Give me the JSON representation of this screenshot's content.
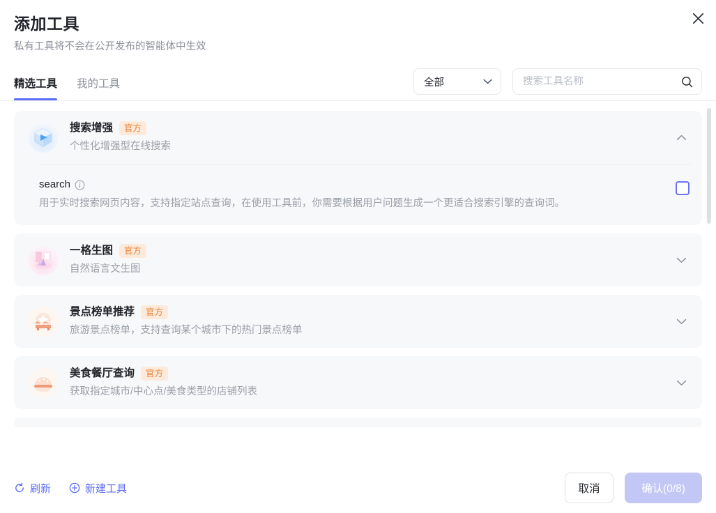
{
  "dialog": {
    "title": "添加工具",
    "subtitle": "私有工具将不会在公开发布的智能体中生效",
    "close_icon": "close-icon"
  },
  "tabs": [
    {
      "label": "精选工具",
      "active": true
    },
    {
      "label": "我的工具",
      "active": false
    }
  ],
  "filter": {
    "selected": "全部",
    "chevron_icon": "chevron-down-icon"
  },
  "search": {
    "value": "",
    "placeholder": "搜索工具名称",
    "icon": "search-icon"
  },
  "tools": [
    {
      "name": "搜索增强",
      "badge": "官方",
      "description": "个性化增强型在线搜索",
      "icon": "cube-icon",
      "expanded": true,
      "chevron_icon": "chevron-up-icon",
      "functions": [
        {
          "name": "search",
          "info_icon": "info-icon",
          "description": "用于实时搜索网页内容，支持指定站点查询，在使用工具前，你需要根据用户问题生成一个更适合搜索引擎的查询词。",
          "checked": false
        }
      ]
    },
    {
      "name": "一格生图",
      "badge": "官方",
      "description": "自然语言文生图",
      "icon": "paint-icon",
      "expanded": false,
      "chevron_icon": "chevron-down-icon",
      "functions": []
    },
    {
      "name": "景点榜单推荐",
      "badge": "官方",
      "description": "旅游景点榜单，支持查询某个城市下的热门景点榜单",
      "icon": "star-landmark-icon",
      "expanded": false,
      "chevron_icon": "chevron-down-icon",
      "functions": []
    },
    {
      "name": "美食餐厅查询",
      "badge": "官方",
      "description": "获取指定城市/中心点/美食类型的店铺列表",
      "icon": "food-icon",
      "expanded": false,
      "chevron_icon": "chevron-down-icon",
      "functions": []
    }
  ],
  "footer": {
    "refresh_label": "刷新",
    "refresh_icon": "refresh-icon",
    "new_tool_label": "新建工具",
    "new_tool_icon": "plus-circle-icon",
    "cancel_label": "取消",
    "confirm_label": "确认(0/8)",
    "confirm_disabled": true
  },
  "colors": {
    "accent": "#5a6bf5",
    "badge_bg": "#fdeadb",
    "badge_text": "#e8833a",
    "card_bg": "#f7f8fa",
    "confirm_disabled_bg": "#c3c7f5",
    "checkbox_border": "#6b73f5"
  }
}
